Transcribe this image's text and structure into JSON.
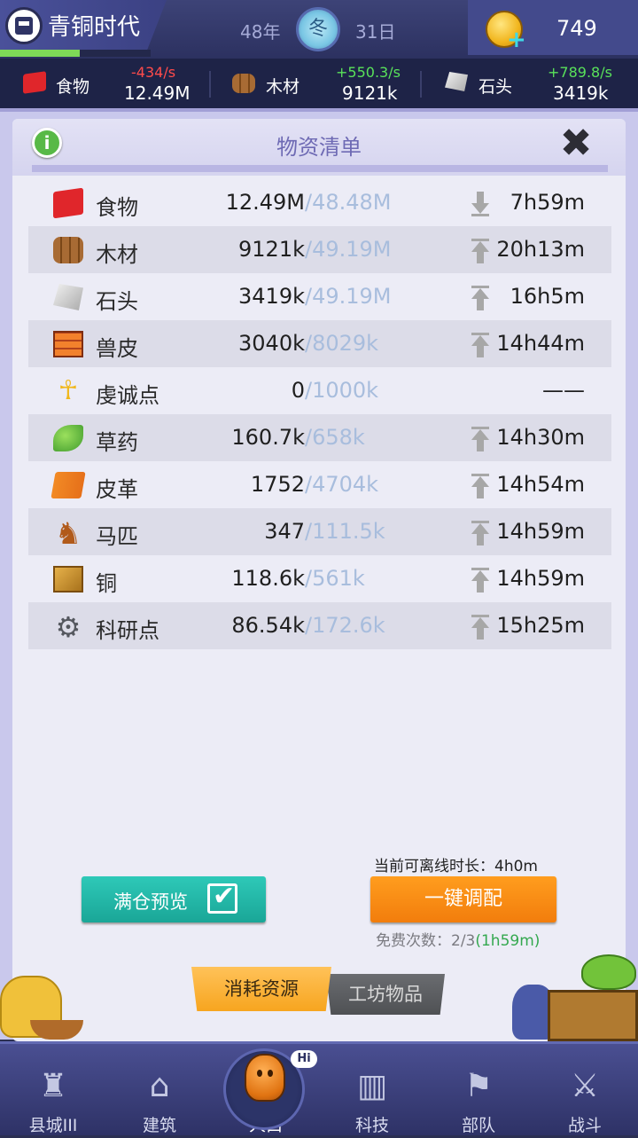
{
  "topbar": {
    "era_title": "青铜时代",
    "era_progress": 0.53,
    "year": "48年",
    "season": "冬",
    "day": "31日",
    "coins": "749"
  },
  "resource_strip": [
    {
      "icon": "food-icon",
      "name": "食物",
      "rate": "-434/s",
      "amount": "12.49M",
      "trend": "negative"
    },
    {
      "icon": "wood-icon",
      "name": "木材",
      "rate": "+550.3/s",
      "amount": "9121k",
      "trend": "positive"
    },
    {
      "icon": "stone-icon",
      "name": "石头",
      "rate": "+789.8/s",
      "amount": "3419k",
      "trend": "positive"
    }
  ],
  "panel": {
    "title": "物资清单",
    "info_label": "i",
    "close_label": "✖"
  },
  "materials": [
    {
      "icon": "food-icon",
      "name": "食物",
      "current": "12.49M",
      "capacity": "/48.48M",
      "trend": "down",
      "time": "7h59m"
    },
    {
      "icon": "wood-icon",
      "name": "木材",
      "current": "9121k",
      "capacity": "/49.19M",
      "trend": "up",
      "time": "20h13m"
    },
    {
      "icon": "stone-icon",
      "name": "石头",
      "current": "3419k",
      "capacity": "/49.19M",
      "trend": "up",
      "time": "16h5m"
    },
    {
      "icon": "hide-icon",
      "name": "兽皮",
      "current": "3040k",
      "capacity": "/8029k",
      "trend": "up",
      "time": "14h44m"
    },
    {
      "icon": "ankh-icon",
      "name": "虔诚点",
      "current": "0",
      "capacity": "/1000k",
      "trend": "none",
      "time": "——"
    },
    {
      "icon": "herb-icon",
      "name": "草药",
      "current": "160.7k",
      "capacity": "/658k",
      "trend": "up",
      "time": "14h30m"
    },
    {
      "icon": "leather-icon",
      "name": "皮革",
      "current": "1752",
      "capacity": "/4704k",
      "trend": "up",
      "time": "14h54m"
    },
    {
      "icon": "horse-icon",
      "name": "马匹",
      "current": "347",
      "capacity": "/111.5k",
      "trend": "up",
      "time": "14h59m"
    },
    {
      "icon": "copper-icon",
      "name": "铜",
      "current": "118.6k",
      "capacity": "/561k",
      "trend": "up",
      "time": "14h59m"
    },
    {
      "icon": "gear-icon",
      "name": "科研点",
      "current": "86.54k",
      "capacity": "/172.6k",
      "trend": "up",
      "time": "15h25m"
    }
  ],
  "actions": {
    "offline_label": "当前可离线时长：4h0m",
    "preview_button": "满仓预览",
    "allocate_button": "一键调配",
    "free_count_prefix": "免费次数：2/3",
    "free_count_timer": "(1h59m)"
  },
  "tabs": {
    "consume": "消耗资源",
    "workshop": "工坊物品"
  },
  "nav": [
    {
      "icon": "county-castle-icon",
      "label": "县城III"
    },
    {
      "icon": "building-house-icon",
      "label": "建筑"
    },
    {
      "icon": "population-avatar-icon",
      "label": "人口",
      "badge": "Hi",
      "active": true
    },
    {
      "icon": "tech-book-icon",
      "label": "科技"
    },
    {
      "icon": "troops-banner-icon",
      "label": "部队"
    },
    {
      "icon": "battle-swords-icon",
      "label": "战斗"
    }
  ],
  "colors": {
    "negative": "#ff4b4b",
    "positive": "#59e25a",
    "panel_title": "#6e6ab4",
    "capacity_text": "#a8bddd",
    "preview_button": "#1fb6a6",
    "allocate_button": "#f58b14"
  }
}
